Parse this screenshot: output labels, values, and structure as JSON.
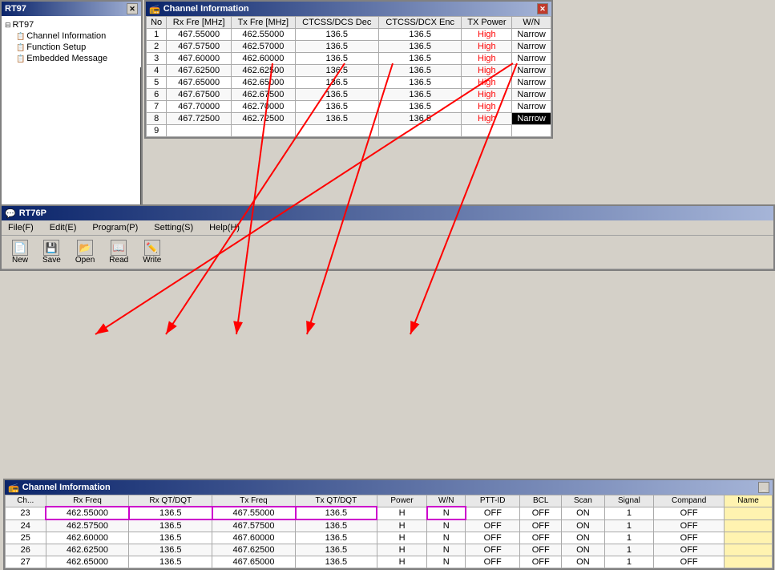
{
  "topWindow": {
    "title": "Channel Information",
    "headers": [
      "No",
      "Rx Fre [MHz]",
      "Tx Fre [MHz]",
      "CTCSS/DCS Dec",
      "CTCSS/DCX Enc",
      "TX Power",
      "W/N"
    ],
    "rows": [
      {
        "no": "1",
        "rxFre": "467.55000",
        "txFre": "462.55000",
        "ctcssDec": "136.5",
        "ctcssEnc": "136.5",
        "txPower": "High",
        "wn": "Narrow"
      },
      {
        "no": "2",
        "rxFre": "467.57500",
        "txFre": "462.57000",
        "ctcssDec": "136.5",
        "ctcssEnc": "136.5",
        "txPower": "High",
        "wn": "Narrow"
      },
      {
        "no": "3",
        "rxFre": "467.60000",
        "txFre": "462.60000",
        "ctcssDec": "136.5",
        "ctcssEnc": "136.5",
        "txPower": "High",
        "wn": "Narrow"
      },
      {
        "no": "4",
        "rxFre": "467.62500",
        "txFre": "462.62500",
        "ctcssDec": "136.5",
        "ctcssEnc": "136.5",
        "txPower": "High",
        "wn": "Narrow"
      },
      {
        "no": "5",
        "rxFre": "467.65000",
        "txFre": "462.65000",
        "ctcssDec": "136.5",
        "ctcssEnc": "136.5",
        "txPower": "High",
        "wn": "Narrow"
      },
      {
        "no": "6",
        "rxFre": "467.67500",
        "txFre": "462.67500",
        "ctcssDec": "136.5",
        "ctcssEnc": "136.5",
        "txPower": "High",
        "wn": "Narrow"
      },
      {
        "no": "7",
        "rxFre": "467.70000",
        "txFre": "462.70000",
        "ctcssDec": "136.5",
        "ctcssEnc": "136.5",
        "txPower": "High",
        "wn": "Narrow"
      },
      {
        "no": "8",
        "rxFre": "467.72500",
        "txFre": "462.72500",
        "ctcssDec": "136.5",
        "ctcssEnc": "136.5",
        "txPower": "High",
        "wn": "Narrow",
        "highlight": true
      },
      {
        "no": "9",
        "rxFre": "",
        "txFre": "",
        "ctcssDec": "",
        "ctcssEnc": "",
        "txPower": "",
        "wn": ""
      }
    ]
  },
  "tree": {
    "title": "RT97",
    "items": [
      {
        "label": "RT97",
        "level": 0,
        "expanded": true
      },
      {
        "label": "Channel Information",
        "level": 1
      },
      {
        "label": "Function Setup",
        "level": 1
      },
      {
        "label": "Embedded Message",
        "level": 1
      }
    ]
  },
  "mainWindow": {
    "title": "RT76P",
    "menu": [
      {
        "label": "File(F)"
      },
      {
        "label": "Edit(E)"
      },
      {
        "label": "Program(P)"
      },
      {
        "label": "Setting(S)"
      },
      {
        "label": "Help(H)"
      }
    ],
    "toolbar": [
      {
        "label": "New",
        "icon": "📄"
      },
      {
        "label": "Save",
        "icon": "💾"
      },
      {
        "label": "Open",
        "icon": "📂"
      },
      {
        "label": "Read",
        "icon": "📖"
      },
      {
        "label": "Write",
        "icon": "✏️"
      }
    ]
  },
  "subWindow": {
    "title": "Channel Imformation",
    "headers": [
      "Ch...",
      "Rx Freq",
      "Rx QT/DQT",
      "Tx Freq",
      "Tx QT/DQT",
      "Power",
      "W/N",
      "PTT-ID",
      "BCL",
      "Scan",
      "Signal",
      "Compand",
      "Name"
    ],
    "rows": [
      {
        "ch": "23",
        "rxFreq": "462.55000",
        "rxQT": "136.5",
        "txFreq": "467.55000",
        "txQT": "136.5",
        "power": "H",
        "wn": "N",
        "pttId": "OFF",
        "bcl": "OFF",
        "scan": "ON",
        "signal": "1",
        "compand": "OFF",
        "name": "",
        "highlighted": true
      },
      {
        "ch": "24",
        "rxFreq": "462.57500",
        "rxQT": "136.5",
        "txFreq": "467.57500",
        "txQT": "136.5",
        "power": "H",
        "wn": "N",
        "pttId": "OFF",
        "bcl": "OFF",
        "scan": "ON",
        "signal": "1",
        "compand": "OFF",
        "name": ""
      },
      {
        "ch": "25",
        "rxFreq": "462.60000",
        "rxQT": "136.5",
        "txFreq": "467.60000",
        "txQT": "136.5",
        "power": "H",
        "wn": "N",
        "pttId": "OFF",
        "bcl": "OFF",
        "scan": "ON",
        "signal": "1",
        "compand": "OFF",
        "name": ""
      },
      {
        "ch": "26",
        "rxFreq": "462.62500",
        "rxQT": "136.5",
        "txFreq": "467.62500",
        "txQT": "136.5",
        "power": "H",
        "wn": "N",
        "pttId": "OFF",
        "bcl": "OFF",
        "scan": "ON",
        "signal": "1",
        "compand": "OFF",
        "name": ""
      },
      {
        "ch": "27",
        "rxFreq": "462.65000",
        "rxQT": "136.5",
        "txFreq": "467.65000",
        "txQT": "136.5",
        "power": "H",
        "wn": "N",
        "pttId": "OFF",
        "bcl": "OFF",
        "scan": "ON",
        "signal": "1",
        "compand": "OFF",
        "name": ""
      }
    ]
  }
}
